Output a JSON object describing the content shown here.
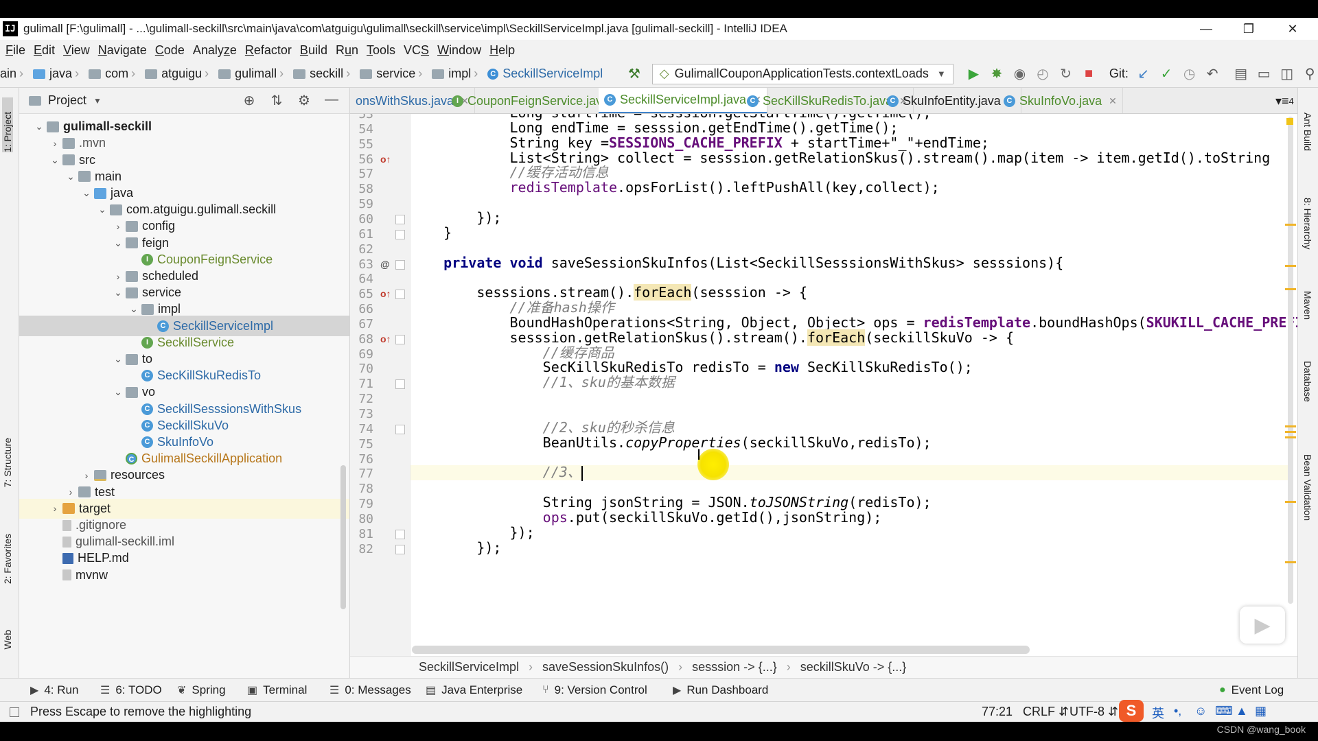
{
  "window": {
    "title": "gulimall [F:\\gulimall] - ...\\gulimall-seckill\\src\\main\\java\\com\\atguigu\\gulimall\\seckill\\service\\impl\\SeckillServiceImpl.java [gulimall-seckill] - IntelliJ IDEA",
    "app_icon": "IJ",
    "controls": [
      "minimize-icon",
      "restore-icon",
      "close-icon"
    ]
  },
  "menu": [
    {
      "label": "File",
      "u": "F"
    },
    {
      "label": "Edit",
      "u": "E"
    },
    {
      "label": "View",
      "u": "V"
    },
    {
      "label": "Navigate",
      "u": "N"
    },
    {
      "label": "Code",
      "u": "C"
    },
    {
      "label": "Analyze",
      "u": "z"
    },
    {
      "label": "Refactor",
      "u": "R"
    },
    {
      "label": "Build",
      "u": "B"
    },
    {
      "label": "Run",
      "u": "u"
    },
    {
      "label": "Tools",
      "u": "T"
    },
    {
      "label": "VCS",
      "u": "S"
    },
    {
      "label": "Window",
      "u": "W"
    },
    {
      "label": "Help",
      "u": "H"
    }
  ],
  "nav": {
    "crumbs": [
      "ain",
      "java",
      "com",
      "atguigu",
      "gulimall",
      "seckill",
      "service",
      "impl",
      "SeckillServiceImpl"
    ],
    "run_config": "GulimallCouponApplicationTests.contextLoads",
    "git_label": "Git:"
  },
  "project_panel": {
    "title": "Project",
    "tree": [
      {
        "label": "gulimall-seckill",
        "depth": 0,
        "arrow": "v",
        "icon": "folder",
        "style": "bold"
      },
      {
        "label": ".mvn",
        "depth": 1,
        "arrow": ">",
        "icon": "folder",
        "style": "gray"
      },
      {
        "label": "src",
        "depth": 1,
        "arrow": "v",
        "icon": "folder"
      },
      {
        "label": "main",
        "depth": 2,
        "arrow": "v",
        "icon": "folder"
      },
      {
        "label": "java",
        "depth": 3,
        "arrow": "v",
        "icon": "src"
      },
      {
        "label": "com.atguigu.gulimall.seckill",
        "depth": 4,
        "arrow": "v",
        "icon": "pkg"
      },
      {
        "label": "config",
        "depth": 5,
        "arrow": ">",
        "icon": "pkg"
      },
      {
        "label": "feign",
        "depth": 5,
        "arrow": "v",
        "icon": "pkg"
      },
      {
        "label": "CouponFeignService",
        "depth": 6,
        "arrow": "",
        "icon": "interface",
        "style": "java"
      },
      {
        "label": "scheduled",
        "depth": 5,
        "arrow": ">",
        "icon": "pkg"
      },
      {
        "label": "service",
        "depth": 5,
        "arrow": "v",
        "icon": "pkg"
      },
      {
        "label": "impl",
        "depth": 6,
        "arrow": "v",
        "icon": "pkg"
      },
      {
        "label": "SeckillServiceImpl",
        "depth": 7,
        "arrow": "",
        "icon": "class",
        "style": "java",
        "selected": true
      },
      {
        "label": "SeckillService",
        "depth": 6,
        "arrow": "",
        "icon": "interface",
        "style": "java"
      },
      {
        "label": "to",
        "depth": 5,
        "arrow": "v",
        "icon": "pkg"
      },
      {
        "label": "SecKillSkuRedisTo",
        "depth": 6,
        "arrow": "",
        "icon": "class",
        "style": "java"
      },
      {
        "label": "vo",
        "depth": 5,
        "arrow": "v",
        "icon": "pkg"
      },
      {
        "label": "SeckillSesssionsWithSkus",
        "depth": 6,
        "arrow": "",
        "icon": "class",
        "style": "java"
      },
      {
        "label": "SeckillSkuVo",
        "depth": 6,
        "arrow": "",
        "icon": "class",
        "style": "java"
      },
      {
        "label": "SkuInfoVo",
        "depth": 6,
        "arrow": "",
        "icon": "class",
        "style": "java"
      },
      {
        "label": "GulimallSeckillApplication",
        "depth": 5,
        "arrow": "",
        "icon": "app",
        "style": "orange"
      },
      {
        "label": "resources",
        "depth": 3,
        "arrow": ">",
        "icon": "res"
      },
      {
        "label": "test",
        "depth": 2,
        "arrow": ">",
        "icon": "folder"
      },
      {
        "label": "target",
        "depth": 1,
        "arrow": ">",
        "icon": "orange",
        "highlight": true
      },
      {
        "label": ".gitignore",
        "depth": 1,
        "arrow": "",
        "icon": "file",
        "style": "gray"
      },
      {
        "label": "gulimall-seckill.iml",
        "depth": 1,
        "arrow": "",
        "icon": "file",
        "style": "gray"
      },
      {
        "label": "HELP.md",
        "depth": 1,
        "arrow": "",
        "icon": "md"
      },
      {
        "label": "mvnw",
        "depth": 1,
        "arrow": "",
        "icon": "file"
      }
    ]
  },
  "left_strip": [
    "1: Project",
    "7: Structure",
    "2: Favorites",
    "Web"
  ],
  "right_strip": [
    "Ant Build",
    "8: Hierarchy",
    "Maven",
    "Database",
    "Bean Validation"
  ],
  "tabs": [
    {
      "label": "onsWithSkus.java",
      "color": "blue",
      "icon": "class"
    },
    {
      "label": "CouponFeignService.java",
      "color": "green",
      "icon": "interface"
    },
    {
      "label": "SeckillServiceImpl.java",
      "color": "green",
      "icon": "class",
      "active": true
    },
    {
      "label": "SecKillSkuRedisTo.java",
      "color": "green",
      "icon": "class"
    },
    {
      "label": "SkuInfoEntity.java",
      "color": "",
      "icon": "class"
    },
    {
      "label": "SkuInfoVo.java",
      "color": "green",
      "icon": "class"
    }
  ],
  "tabs_overflow": "4",
  "code": {
    "lines": [
      {
        "n": "53",
        "html": "            <span>Long startTime = sesssion.getStartTime().getTime();</span>"
      },
      {
        "n": "54",
        "html": "            Long endTime = sesssion.getEndTime().getTime();"
      },
      {
        "n": "55",
        "html": "            String key =<span class=\"fld\">SESSIONS_CACHE_PREFIX</span> + startTime+<span class=\"str\">\"_\"</span>+endTime;"
      },
      {
        "n": "56",
        "mark": "override",
        "html": "            List&lt;String&gt; collect = sesssion.getRelationSkus().stream().map(item -&gt; item.getId().toString"
      },
      {
        "n": "57",
        "html": "            <span class=\"cm\">//缓存活动信息</span>"
      },
      {
        "n": "58",
        "html": "            <span class=\"fldn\">redisTemplate</span>.opsForList().leftPushAll(key,collect);"
      },
      {
        "n": "59",
        "html": ""
      },
      {
        "n": "60",
        "fold": true,
        "html": "        });"
      },
      {
        "n": "61",
        "fold": true,
        "html": "    }"
      },
      {
        "n": "62",
        "html": ""
      },
      {
        "n": "63",
        "mark": "at",
        "fold": true,
        "html": "    <span class=\"kw\">private void</span> saveSessionSkuInfos(List&lt;SeckillSesssionsWithSkus&gt; sesssions){"
      },
      {
        "n": "64",
        "html": ""
      },
      {
        "n": "65",
        "mark": "override",
        "fold": true,
        "html": "        sesssions.stream().<span class=\"hlw\">forEach</span>(sesssion -&gt; {"
      },
      {
        "n": "66",
        "html": "            <span class=\"cm\">//准备hash操作</span>"
      },
      {
        "n": "67",
        "html": "            BoundHashOperations&lt;String, Object, Object&gt; ops = <span class=\"fld\">redisTemplate</span>.boundHashOps(<span class=\"fld\">SKUKILL_CACHE_PREFIX</span>);"
      },
      {
        "n": "68",
        "mark": "override",
        "fold": true,
        "html": "            sesssion.getRelationSkus().stream().<span class=\"hlw\">forEach</span>(seckillSkuVo -&gt; {"
      },
      {
        "n": "69",
        "html": "                <span class=\"cm\">//缓存商品</span>"
      },
      {
        "n": "70",
        "html": "                SecKillSkuRedisTo redisTo = <span class=\"kw\">new</span> SecKillSkuRedisTo();"
      },
      {
        "n": "71",
        "fold": true,
        "html": "                <span class=\"cm\">//1、sku的基本数据</span>"
      },
      {
        "n": "72",
        "html": ""
      },
      {
        "n": "73",
        "html": ""
      },
      {
        "n": "74",
        "fold": true,
        "html": "                <span class=\"cm\">//2、sku的秒杀信息</span>"
      },
      {
        "n": "75",
        "html": "                BeanUtils.<span class=\"it\">copyProperties</span>(seckillSkuVo,redisTo);"
      },
      {
        "n": "76",
        "html": ""
      },
      {
        "n": "77",
        "current": true,
        "html": "                <span class=\"cm\">//3、</span><span class=\"caret\"></span>"
      },
      {
        "n": "78",
        "html": ""
      },
      {
        "n": "79",
        "html": "                String jsonString = JSON.<span class=\"it\">toJSONString</span>(redisTo);"
      },
      {
        "n": "80",
        "html": "                <span class=\"fldn\">ops</span>.put(seckillSkuVo.getId(),jsonString);"
      },
      {
        "n": "81",
        "fold": true,
        "html": "            });"
      },
      {
        "n": "82",
        "fold": true,
        "html": "        });"
      }
    ]
  },
  "editor_breadcrumb": [
    "SeckillServiceImpl",
    "saveSessionSkuInfos()",
    "sesssion -> {...}",
    "seckillSkuVo -> {...}"
  ],
  "tool_windows": [
    {
      "label": "4: Run",
      "icon": "▶"
    },
    {
      "label": "6: TODO",
      "icon": "☰"
    },
    {
      "label": "Spring",
      "icon": "❦"
    },
    {
      "label": "Terminal",
      "icon": "▣"
    },
    {
      "label": "0: Messages",
      "icon": "☰"
    },
    {
      "label": "Java Enterprise",
      "icon": "▤"
    },
    {
      "label": "9: Version Control",
      "icon": "⑂"
    },
    {
      "label": "Run Dashboard",
      "icon": "▶"
    },
    {
      "label": "Event Log",
      "icon": "●"
    }
  ],
  "status": {
    "message": "Press Escape to remove the highlighting",
    "position": "77:21",
    "line_sep": "CRLF",
    "encoding": "UTF-8",
    "ime_label": "英"
  },
  "watermark": "CSDN @wang_book"
}
